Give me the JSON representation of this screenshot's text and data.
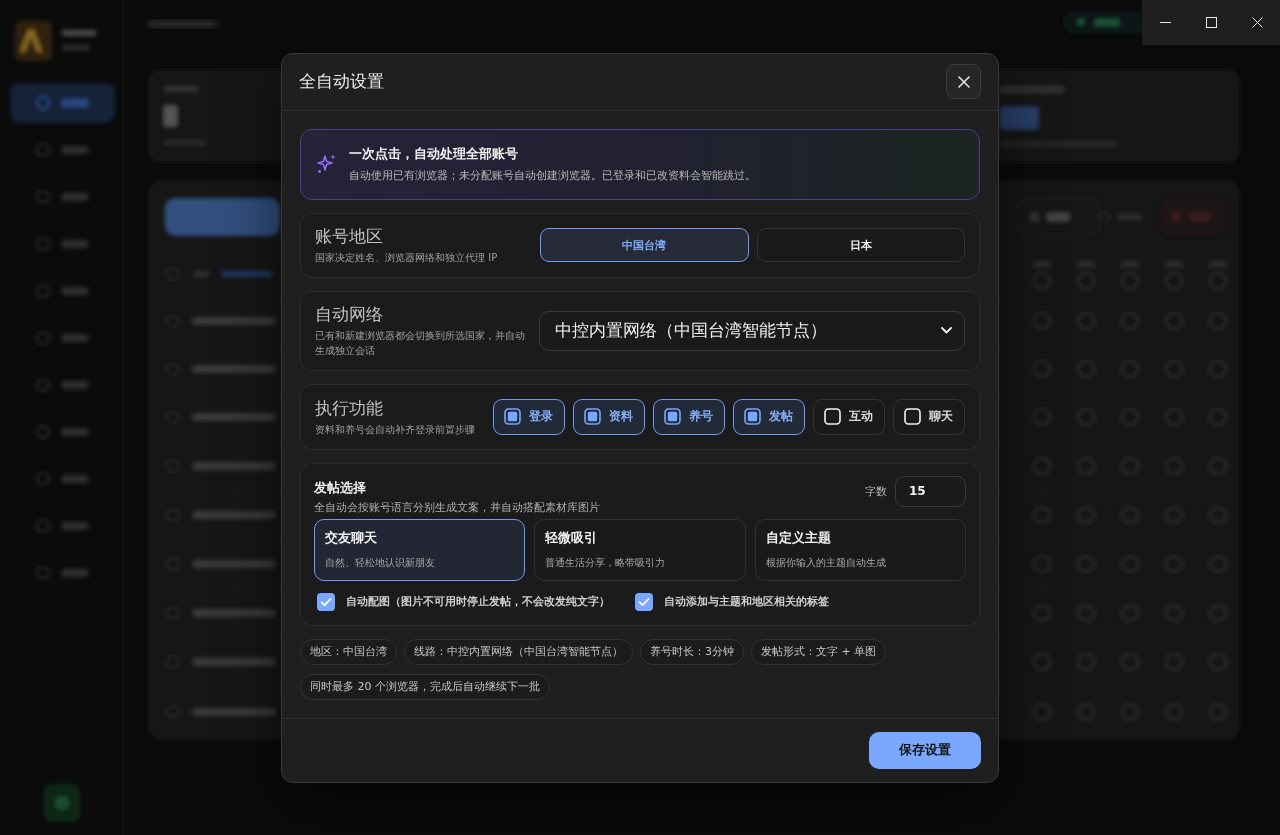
{
  "dialog": {
    "title": "全自动设置"
  },
  "banner": {
    "title": "一次点击，自动处理全部账号",
    "text": "自动使用已有浏览器；未分配账号自动创建浏览器。已登录和已改资料会智能跳过。"
  },
  "region": {
    "label": "账号地区",
    "hint": "国家决定姓名、浏览器网络和独立代理 IP",
    "options": [
      {
        "label": "中国台湾",
        "selected": true
      },
      {
        "label": "日本",
        "selected": false
      }
    ]
  },
  "network": {
    "label": "自动网络",
    "hint": "已有和新建浏览器都会切换到所选国家，并自动生成独立会话",
    "value": "中控内置网络（中国台湾智能节点）"
  },
  "functions": {
    "label": "执行功能",
    "hint": "资料和养号会自动补齐登录前置步骤",
    "items": [
      {
        "label": "登录",
        "checked": true
      },
      {
        "label": "资料",
        "checked": true
      },
      {
        "label": "养号",
        "checked": true
      },
      {
        "label": "发帖",
        "checked": true
      },
      {
        "label": "互动",
        "checked": false
      },
      {
        "label": "聊天",
        "checked": false
      }
    ]
  },
  "posting": {
    "title": "发帖选择",
    "hint": "全自动会按账号语言分别生成文案，并自动搭配素材库图片",
    "word_count": {
      "label": "字数",
      "value": "15"
    },
    "styles": [
      {
        "title": "交友聊天",
        "desc": "自然、轻松地认识新朋友",
        "selected": true
      },
      {
        "title": "轻微吸引",
        "desc": "普通生活分享，略带吸引力",
        "selected": false
      },
      {
        "title": "自定义主题",
        "desc": "根据你输入的主题自动生成",
        "selected": false
      }
    ],
    "options": [
      {
        "label": "自动配图（图片不可用时停止发帖，不会改发纯文字）",
        "checked": true
      },
      {
        "label": "自动添加与主题和地区相关的标签",
        "checked": true
      }
    ]
  },
  "summary": [
    "地区：中国台湾",
    "线路：中控内置网络（中国台湾智能节点）",
    "养号时长：3分钟",
    "发帖形式：文字 + 单图",
    "同时最多 20 个浏览器，完成后自动继续下一批"
  ],
  "footer": {
    "save_button": "保存设置"
  }
}
